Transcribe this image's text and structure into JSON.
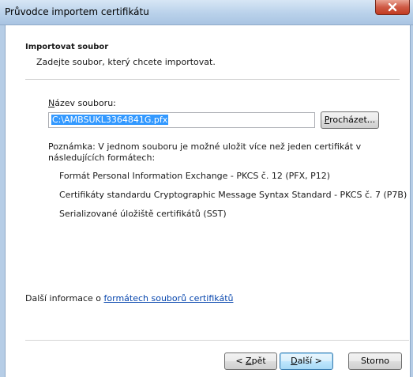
{
  "window": {
    "title": "Průvodce importem certifikátu"
  },
  "header": {
    "title": "Importovat soubor",
    "subtitle": "Zadejte soubor, který chcete importovat."
  },
  "file": {
    "label_prefix": "",
    "label_accel": "N",
    "label_rest": "ázev souboru:",
    "value": "C:\\AMBSUKL3364841G.pfx",
    "browse_accel": "P",
    "browse_rest": "rocházet..."
  },
  "note": {
    "text": "Poznámka: V jednom souboru je možné uložit více než jeden certifikát v následujících formátech:",
    "formats": [
      "Formát Personal Information Exchange - PKCS č. 12 (PFX, P12)",
      "Certifikáty standardu Cryptographic Message Syntax Standard - PKCS č. 7 (P7B)",
      "Serializované úložiště certifikátů (SST)"
    ]
  },
  "info": {
    "prefix": "Další informace o ",
    "link": "formátech souborů certifikátů"
  },
  "buttons": {
    "back_prefix": "< ",
    "back_accel": "Z",
    "back_rest": "pět",
    "next_accel": "D",
    "next_rest": "alší >",
    "cancel": "Storno"
  }
}
